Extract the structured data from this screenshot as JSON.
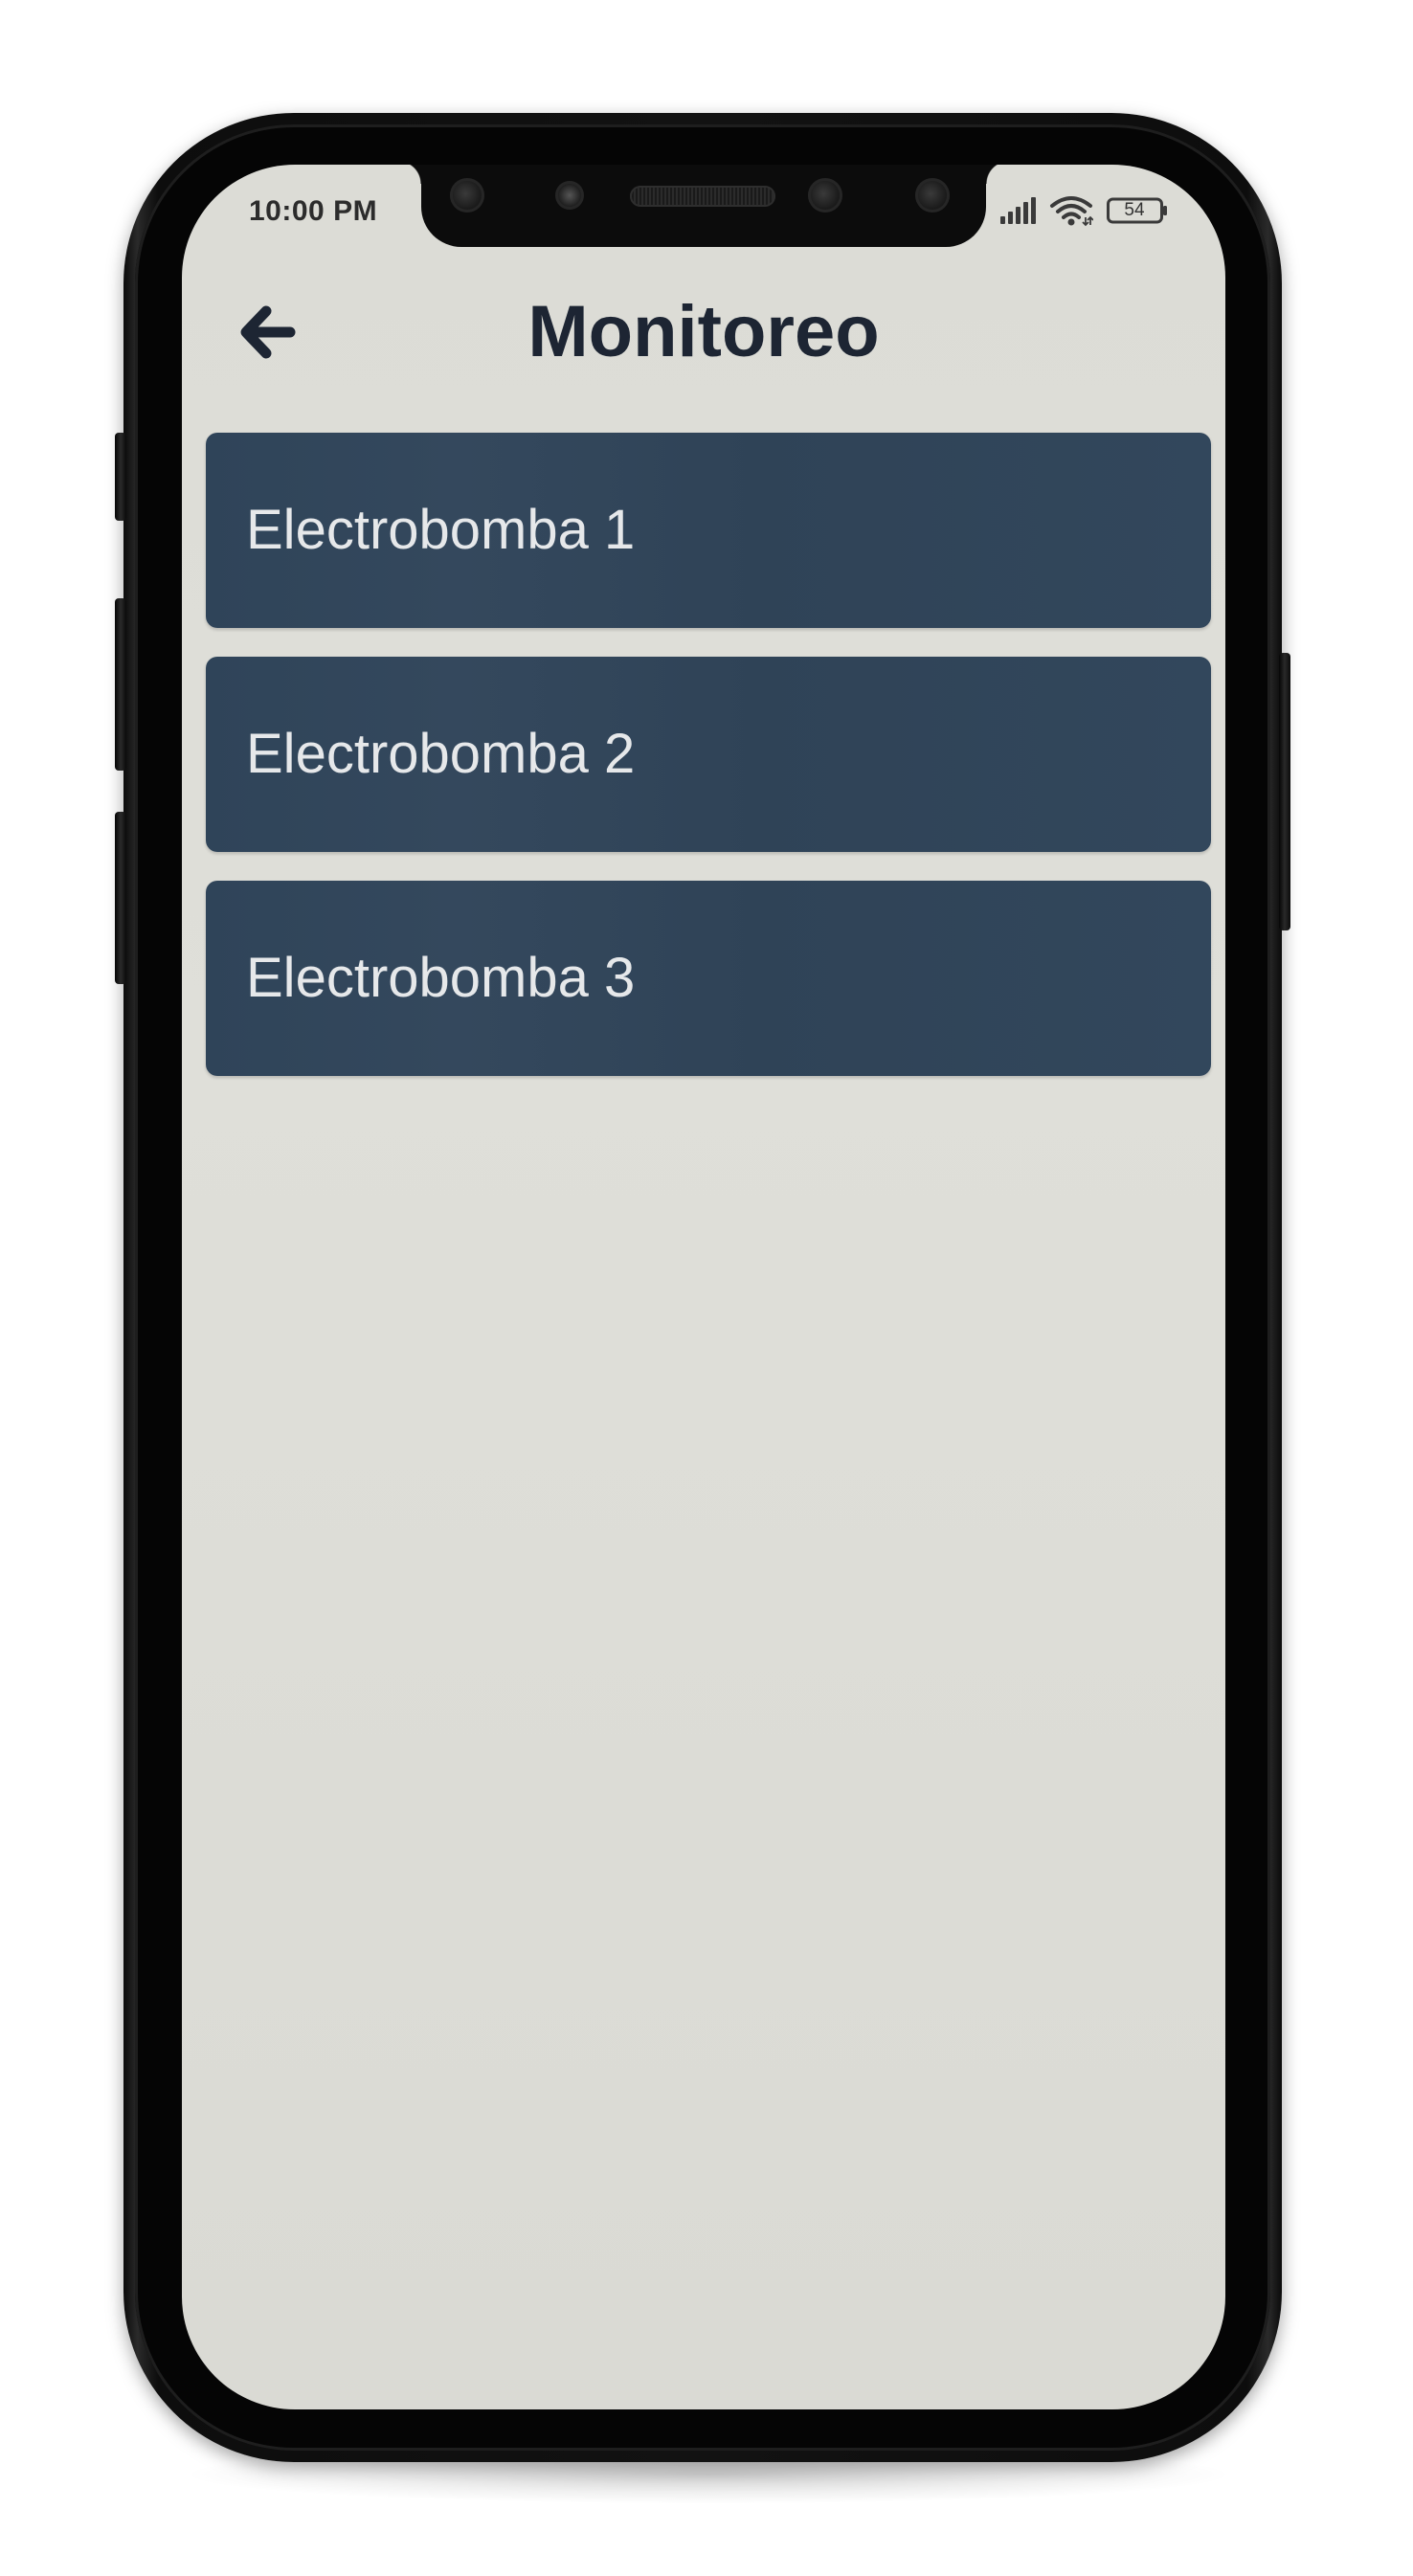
{
  "status_bar": {
    "time": "10:00 PM",
    "battery": "54",
    "signal_icon": "cellular-signal-icon",
    "wifi_icon": "wifi-icon",
    "battery_icon": "battery-icon"
  },
  "header": {
    "title": "Monitoreo",
    "back_icon": "arrow-left-icon"
  },
  "devices": {
    "items": [
      {
        "label": "Electrobomba 1"
      },
      {
        "label": "Electrobomba 2"
      },
      {
        "label": "Electrobomba 3"
      }
    ]
  },
  "colors": {
    "screen_background": "#dcdcd6",
    "item_background": "#2f4459",
    "item_text": "#e6e8ea",
    "title_text": "#1d2533"
  }
}
